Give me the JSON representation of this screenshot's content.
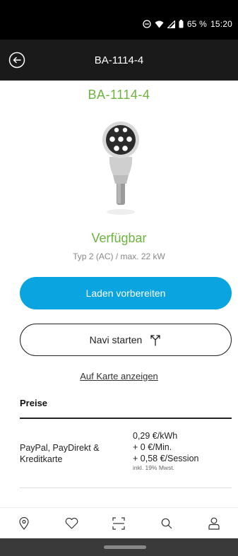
{
  "status_bar": {
    "battery": "65 %",
    "time": "15:20"
  },
  "header": {
    "title": "BA-1114-4"
  },
  "station": {
    "title": "BA-1114-4",
    "status": "Verfügbar",
    "type_info": "Typ 2 (AC) / max. 22 kW"
  },
  "actions": {
    "prepare_label": "Laden vorbereiten",
    "navigate_label": "Navi starten",
    "map_link": "Auf Karte anzeigen"
  },
  "prices": {
    "section_title": "Preise",
    "payment_methods": "PayPal, PayDirekt & Kreditkarte",
    "lines": [
      "0,29 €/kWh",
      "+ 0 €/Min.",
      "+ 0,58 €/Session"
    ],
    "note": "inkl. 19% Mwst."
  },
  "bottom_nav": {
    "items": [
      "location-pin-icon",
      "heart-icon",
      "scan-icon",
      "search-icon",
      "user-icon"
    ]
  },
  "colors": {
    "accent_green": "#6cb33f",
    "primary_blue": "#0aa5e0",
    "header_bg": "#1a1a1a"
  }
}
